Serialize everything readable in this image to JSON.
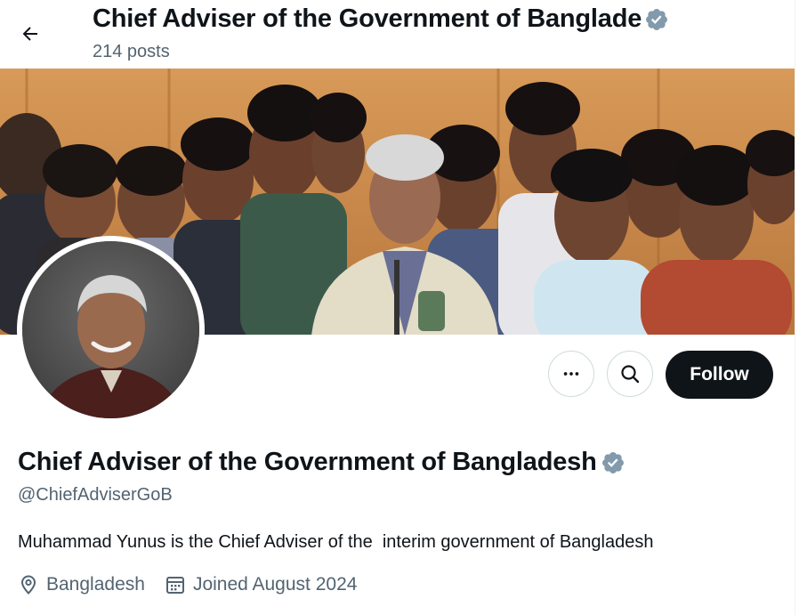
{
  "header": {
    "title": "Chief Adviser of the Government of Banglade",
    "posts": "214 posts"
  },
  "icons": {
    "back": "arrow-left-icon",
    "verified": "verified-badge-icon",
    "more": "ellipsis-icon",
    "search": "search-icon",
    "location": "location-pin-icon",
    "calendar": "calendar-icon"
  },
  "actions": {
    "follow_label": "Follow"
  },
  "profile": {
    "name": "Chief Adviser of the Government of Bangladesh",
    "handle": "@ChiefAdviserGoB",
    "bio": "Muhammad Yunus is the Chief Adviser of the  interim government of Bangladesh",
    "location": "Bangladesh",
    "joined": "Joined August 2024"
  },
  "colors": {
    "text_primary": "#0f1419",
    "text_secondary": "#536471",
    "verified_badge": "#829aab",
    "follow_bg": "#0f1419",
    "border": "#cfd9de"
  }
}
